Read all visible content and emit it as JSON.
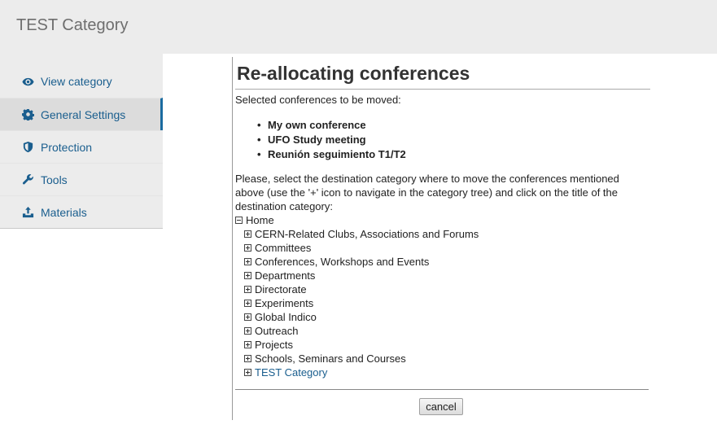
{
  "header": {
    "title": "TEST Category"
  },
  "sidebar": {
    "items": [
      {
        "label": "View category",
        "icon": "eye-icon",
        "active": false
      },
      {
        "label": "General Settings",
        "icon": "gear-icon",
        "active": true
      },
      {
        "label": "Protection",
        "icon": "shield-icon",
        "active": false
      },
      {
        "label": "Tools",
        "icon": "wrench-icon",
        "active": false
      },
      {
        "label": "Materials",
        "icon": "upload-icon",
        "active": false
      }
    ]
  },
  "main": {
    "title": "Re-allocating conferences",
    "intro": "Selected conferences to be moved:",
    "conferences": [
      "My own conference",
      "UFO Study meeting",
      "Reunión seguimiento T1/T2"
    ],
    "instructions": "Please, select the destination category where to move the conferences mentioned above (use the '+' icon to navigate in the category tree) and click on the title of the destination category:",
    "tree": {
      "root": "Home",
      "children": [
        "CERN-Related Clubs, Associations and Forums",
        "Committees",
        "Conferences, Workshops and Events",
        "Departments",
        "Directorate",
        "Experiments",
        "Global Indico",
        "Outreach",
        "Projects",
        "Schools, Seminars and Courses",
        "TEST Category"
      ]
    },
    "cancel_label": "cancel"
  },
  "colors": {
    "link": "#1a5e8e",
    "header_bg": "#ececec",
    "active_border": "#1a6ba0"
  }
}
